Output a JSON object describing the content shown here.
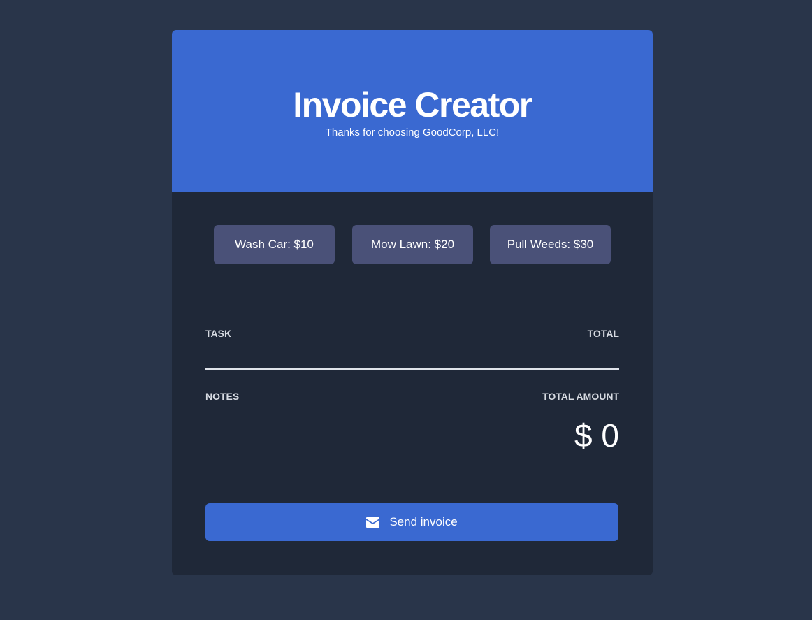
{
  "header": {
    "title": "Invoice Creator",
    "subtitle": "Thanks for choosing GoodCorp, LLC!"
  },
  "services": [
    {
      "label": "Wash Car: $10"
    },
    {
      "label": "Mow Lawn: $20"
    },
    {
      "label": "Pull Weeds: $30"
    }
  ],
  "table": {
    "task_header": "TASK",
    "total_header": "TOTAL"
  },
  "summary": {
    "notes_label": "NOTES",
    "total_amount_label": "TOTAL AMOUNT",
    "total_amount_value": "$ 0"
  },
  "send": {
    "label": "Send invoice",
    "icon": "envelope-icon"
  },
  "colors": {
    "page_bg": "#29354a",
    "card_bg": "#1f2838",
    "accent": "#3a69d1",
    "service_button": "#4a5178"
  }
}
